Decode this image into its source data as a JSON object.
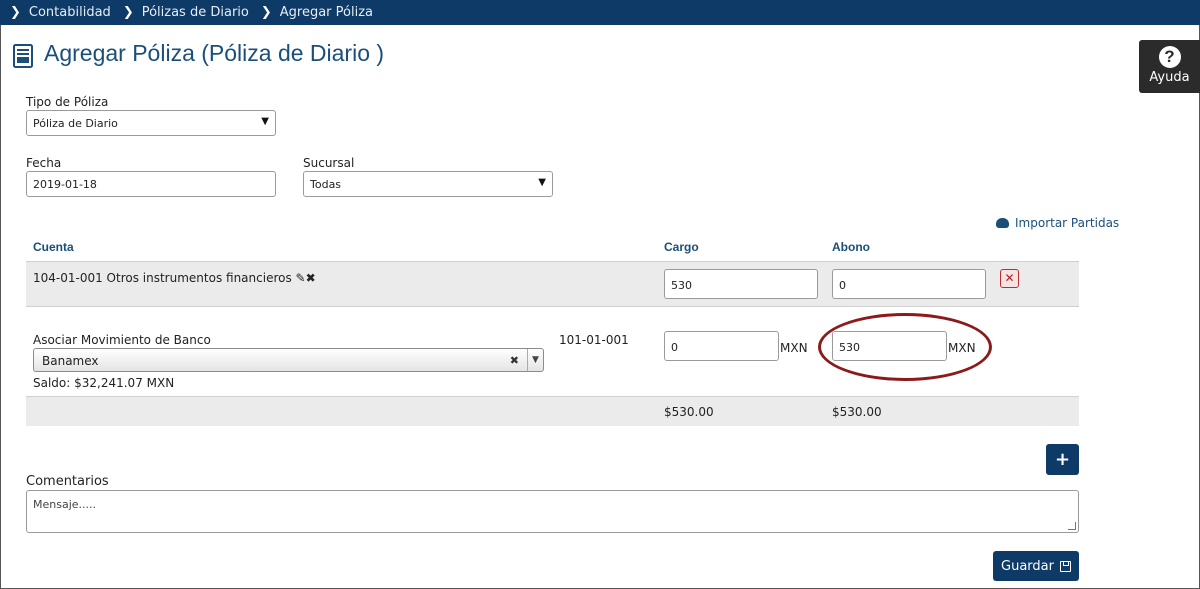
{
  "breadcrumb": [
    "Contabilidad",
    "Pólizas de Diario",
    "Agregar Póliza"
  ],
  "page_title": "Agregar Póliza (Póliza de Diario )",
  "help_label": "Ayuda",
  "form": {
    "tipo_label": "Tipo de Póliza",
    "tipo_value": "Póliza de Diario",
    "fecha_label": "Fecha",
    "fecha_value": "2019-01-18",
    "sucursal_label": "Sucursal",
    "sucursal_value": "Todas"
  },
  "import_label": "Importar Partidas",
  "table": {
    "headers": {
      "cuenta": "Cuenta",
      "cargo": "Cargo",
      "abono": "Abono"
    },
    "row1": {
      "cuenta": "104-01-001 Otros instrumentos financieros",
      "cargo": "530",
      "abono": "0"
    },
    "row2": {
      "asociar_label": "Asociar Movimiento de Banco",
      "bank_value": "Banamex",
      "saldo": "Saldo: $32,241.07 MXN",
      "cuenta": "101-01-001",
      "cargo": "0",
      "abono": "530",
      "currency": "MXN"
    },
    "totals": {
      "cargo": "$530.00",
      "abono": "$530.00"
    }
  },
  "comments": {
    "label": "Comentarios",
    "placeholder": "Mensaje....."
  },
  "save_label": "Guardar",
  "colors": {
    "navy": "#0d3a66",
    "title_blue": "#1b4f7a",
    "highlight_red": "#8b1a1a"
  }
}
